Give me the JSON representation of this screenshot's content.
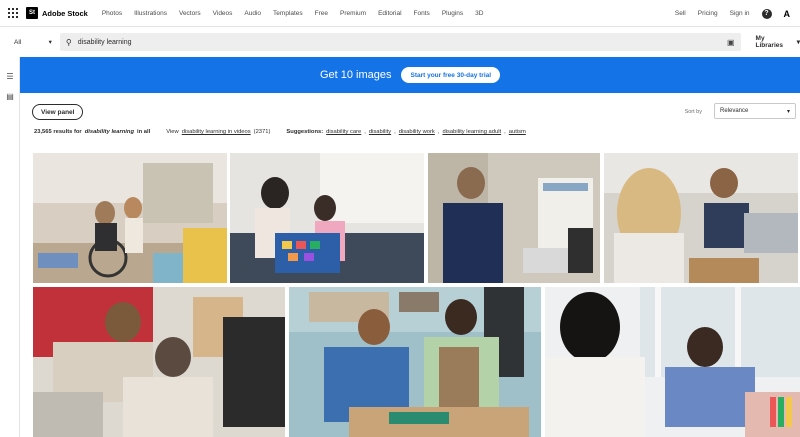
{
  "nav": {
    "logo_mark": "St",
    "logo_text": "Adobe Stock",
    "items": [
      "Photos",
      "Illustrations",
      "Vectors",
      "Videos",
      "Audio",
      "Templates",
      "Free",
      "Premium",
      "Editorial",
      "Fonts",
      "Plugins",
      "3D"
    ],
    "right": {
      "sell": "Sell",
      "pricing": "Pricing",
      "signin": "Sign in",
      "help_glyph": "?",
      "adobe_glyph": "A"
    }
  },
  "search": {
    "scope": "All",
    "query": "disability learning",
    "my_libraries": "My Libraries"
  },
  "banner": {
    "text": "Get 10 images",
    "cta": "Start your free 30-day trial"
  },
  "toolbar": {
    "view_panel": "View panel",
    "sort_label": "Sort by",
    "sort_value": "Relevance"
  },
  "results": {
    "count": "23,565 results for",
    "query": "disability learning",
    "scope": "in all",
    "view_prefix": "View",
    "video_link": "disability learning in videos",
    "video_count": "(2371)",
    "suggestions_label": "Suggestions:",
    "suggestions": [
      "disability care",
      "disability",
      "disability work",
      "disability learning adult",
      "autism"
    ]
  },
  "colors": {
    "accent": "#1473e6",
    "text": "#2c2c2c"
  }
}
